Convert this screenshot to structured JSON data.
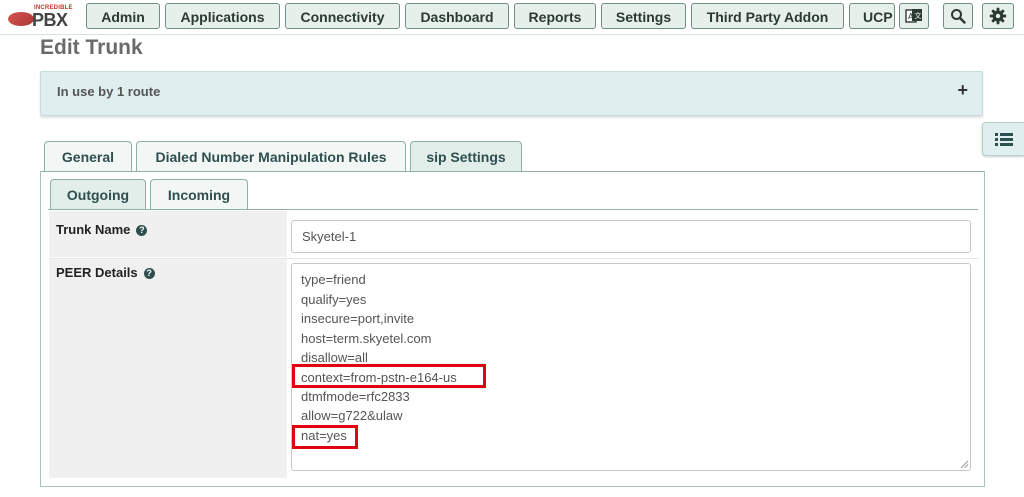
{
  "logo": {
    "top_text": "INCREDIBLE",
    "main_text": "PBX"
  },
  "nav": {
    "items": [
      "Admin",
      "Applications",
      "Connectivity",
      "Dashboard",
      "Reports",
      "Settings",
      "Third Party Addon",
      "UCP"
    ],
    "icons": [
      "language-icon",
      "search-icon",
      "gear-icon"
    ]
  },
  "page": {
    "title": "Edit Trunk"
  },
  "route_panel": {
    "text": "In use by 1 route",
    "expand_symbol": "+"
  },
  "tabs": [
    "General",
    "Dialed Number Manipulation Rules",
    "sip Settings"
  ],
  "active_tab": "sip Settings",
  "subtabs": [
    "Outgoing",
    "Incoming"
  ],
  "active_subtab": "Outgoing",
  "form": {
    "trunk_name_label": "Trunk Name",
    "trunk_name_value": "Skyetel-1",
    "peer_details_label": "PEER Details",
    "peer_lines": [
      "type=friend",
      "qualify=yes",
      "insecure=port,invite",
      "host=term.skyetel.com",
      "disallow=all",
      "context=from-pstn-e164-us",
      "dtmfmode=rfc2833",
      "allow=g722&ulaw",
      "nat=yes"
    ],
    "help_symbol": "?"
  },
  "colors": {
    "highlight": "#e00010",
    "accent": "#2f4f4f",
    "panel": "#dfeeee"
  }
}
